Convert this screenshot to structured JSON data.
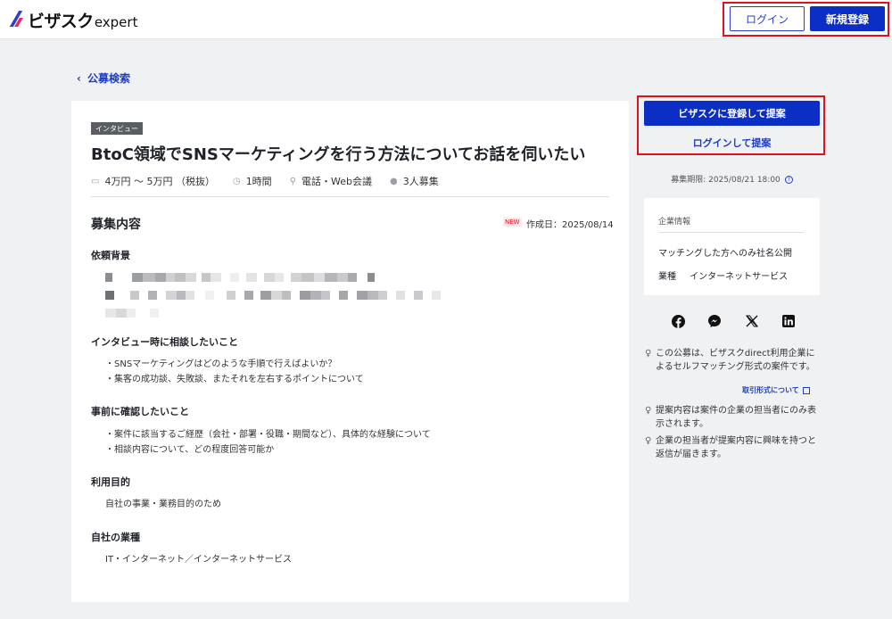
{
  "header": {
    "logo_jp": "ビザスク",
    "logo_en": "expert",
    "login_label": "ログイン",
    "register_label": "新規登録"
  },
  "back_link": "公募検索",
  "card": {
    "badge": "インタビュー",
    "title": "BtoC領域でSNSマーケティングを行う方法についてお話を伺いたい",
    "meta": [
      {
        "icon": "money-icon",
        "text": "4万円 〜 5万円 （税抜）"
      },
      {
        "icon": "clock-icon",
        "text": "1時間"
      },
      {
        "icon": "location-pin-icon",
        "text": "電話・Web会議"
      },
      {
        "icon": "person-icon",
        "text": "3人募集"
      }
    ],
    "section_title": "募集内容",
    "new_badge": "NEW",
    "created": "作成日：2025/08/14",
    "background_heading": "依頼背景",
    "interview_heading": "インタビュー時に相談したいこと",
    "interview_items": [
      "・SNSマーケティングはどのような手順で行えばよいか？",
      "・集客の成功談、失敗談、またそれを左右するポイントについて"
    ],
    "confirm_heading": "事前に確認したいこと",
    "confirm_items": [
      "・案件に該当するご経歴（会社・部署・役職・期間など）、具体的な経験について",
      "・相談内容について、どの程度回答可能か"
    ],
    "purpose_heading": "利用目的",
    "purpose_text": "自社の事業・業務目的のため",
    "industry_heading": "自社の業種",
    "industry_text": "IT・インターネット／インターネットサービス"
  },
  "side": {
    "propose_button": "ビザスクに登録して提案",
    "login_propose": "ログインして提案",
    "deadline": "募集期限: 2025/08/21 18:00",
    "company_head": "企業情報",
    "company_name": "マッチングした方へのみ社名公開",
    "industry_label": "業種",
    "industry_value": "インターネットサービス",
    "notes": [
      "この公募は、ビザスクdirect利用企業によるセルフマッチング形式の案件です。",
      "提案内容は案件の企業の担当者にのみ表示されます。",
      "企業の担当者が提案内容に興味を持つと返信が届きます。"
    ],
    "trade_link": "取引形式について"
  },
  "colors": {
    "primary": "#0b2fc4",
    "highlight": "#e0111b"
  }
}
